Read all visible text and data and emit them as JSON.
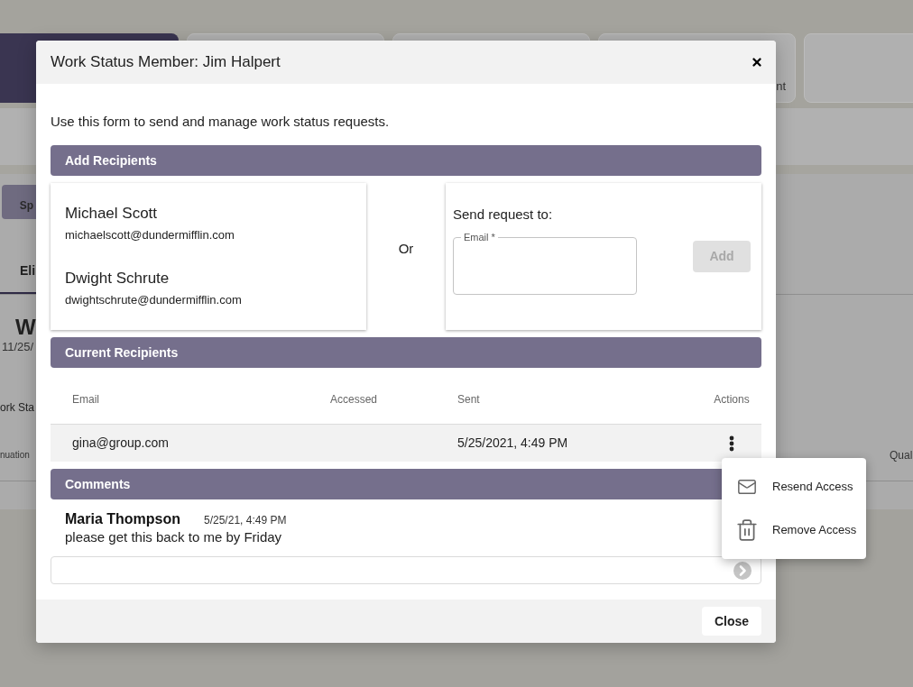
{
  "background": {
    "cards": [
      {
        "selected": true
      },
      {
        "selected": false
      },
      {
        "selected": false
      },
      {
        "selected": false,
        "text": "nt"
      },
      {
        "selected": false
      }
    ],
    "button": "Sp",
    "tab": "Eli",
    "heading": "W",
    "date": "11/25/",
    "section_title": "ork Sta",
    "column_1": "nuation",
    "column_2": "Qual"
  },
  "modal": {
    "title": "Work Status Member: Jim Halpert",
    "intro": "Use this form to send and manage work status requests.",
    "add_recipients": {
      "heading": "Add Recipients",
      "suggestions": [
        {
          "name": "Michael Scott",
          "email": "michaelscott@dundermifflin.com"
        },
        {
          "name": "Dwight Schrute",
          "email": "dwightschrute@dundermifflin.com"
        }
      ],
      "separator": "Or",
      "send_request": {
        "label": "Send request to:",
        "email_field": {
          "label": "Email *"
        },
        "add_button": {
          "label": "Add",
          "disabled": true
        }
      }
    },
    "current_recipients": {
      "heading": "Current Recipients",
      "columns": [
        "Email",
        "Accessed",
        "Sent",
        "Actions"
      ],
      "rows": [
        {
          "email": "gina@group.com",
          "sent": "5/25/2021, 4:49 PM"
        }
      ]
    },
    "comments": {
      "heading": "Comments",
      "items": [
        {
          "author": "Maria Thompson",
          "time": "5/25/21, 4:49 PM",
          "text": "please get this back to me by Friday"
        }
      ]
    },
    "footer": {
      "close_button": "Close"
    }
  },
  "action_menu": {
    "items": [
      {
        "kind": "resend",
        "label": "Resend Access"
      },
      {
        "kind": "remove",
        "label": "Remove Access"
      }
    ]
  }
}
